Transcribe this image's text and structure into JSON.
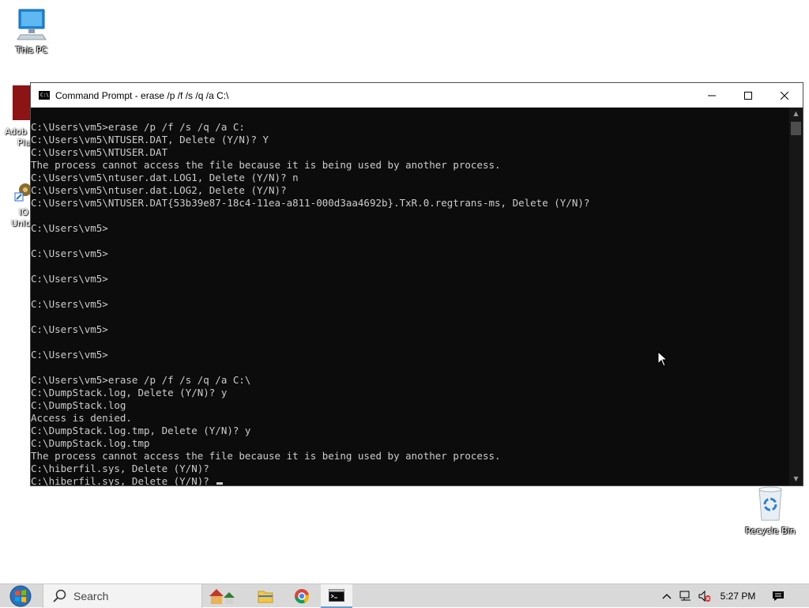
{
  "desktop": {
    "icons": [
      {
        "label": "This PC"
      },
      {
        "label": "Recycle Bin"
      }
    ],
    "partial_labels": [
      "Adob",
      "Pla",
      "IO",
      "Unlo"
    ]
  },
  "window": {
    "title": "Command Prompt - erase  /p /f /s /q /a C:\\",
    "icon_text": "C:\\"
  },
  "console": {
    "lines": [
      "C:\\Users\\vm5>erase /p /f /s /q /a C:",
      "C:\\Users\\vm5\\NTUSER.DAT, Delete (Y/N)? Y",
      "C:\\Users\\vm5\\NTUSER.DAT",
      "The process cannot access the file because it is being used by another process.",
      "C:\\Users\\vm5\\ntuser.dat.LOG1, Delete (Y/N)? n",
      "C:\\Users\\vm5\\ntuser.dat.LOG2, Delete (Y/N)?",
      "C:\\Users\\vm5\\NTUSER.DAT{53b39e87-18c4-11ea-a811-000d3aa4692b}.TxR.0.regtrans-ms, Delete (Y/N)?",
      "",
      "C:\\Users\\vm5>",
      "",
      "C:\\Users\\vm5>",
      "",
      "C:\\Users\\vm5>",
      "",
      "C:\\Users\\vm5>",
      "",
      "C:\\Users\\vm5>",
      "",
      "C:\\Users\\vm5>",
      "",
      "C:\\Users\\vm5>erase /p /f /s /q /a C:\\",
      "C:\\DumpStack.log, Delete (Y/N)? y",
      "C:\\DumpStack.log",
      "Access is denied.",
      "C:\\DumpStack.log.tmp, Delete (Y/N)? y",
      "C:\\DumpStack.log.tmp",
      "The process cannot access the file because it is being used by another process.",
      "C:\\hiberfil.sys, Delete (Y/N)?",
      "C:\\hiberfil.sys, Delete (Y/N)? "
    ]
  },
  "taskbar": {
    "search_placeholder": "Search",
    "clock": "5:27 PM"
  },
  "colors": {
    "console_bg": "#0c0c0c",
    "console_text": "#cccccc",
    "taskbar_bg": "#d9d9d9"
  }
}
